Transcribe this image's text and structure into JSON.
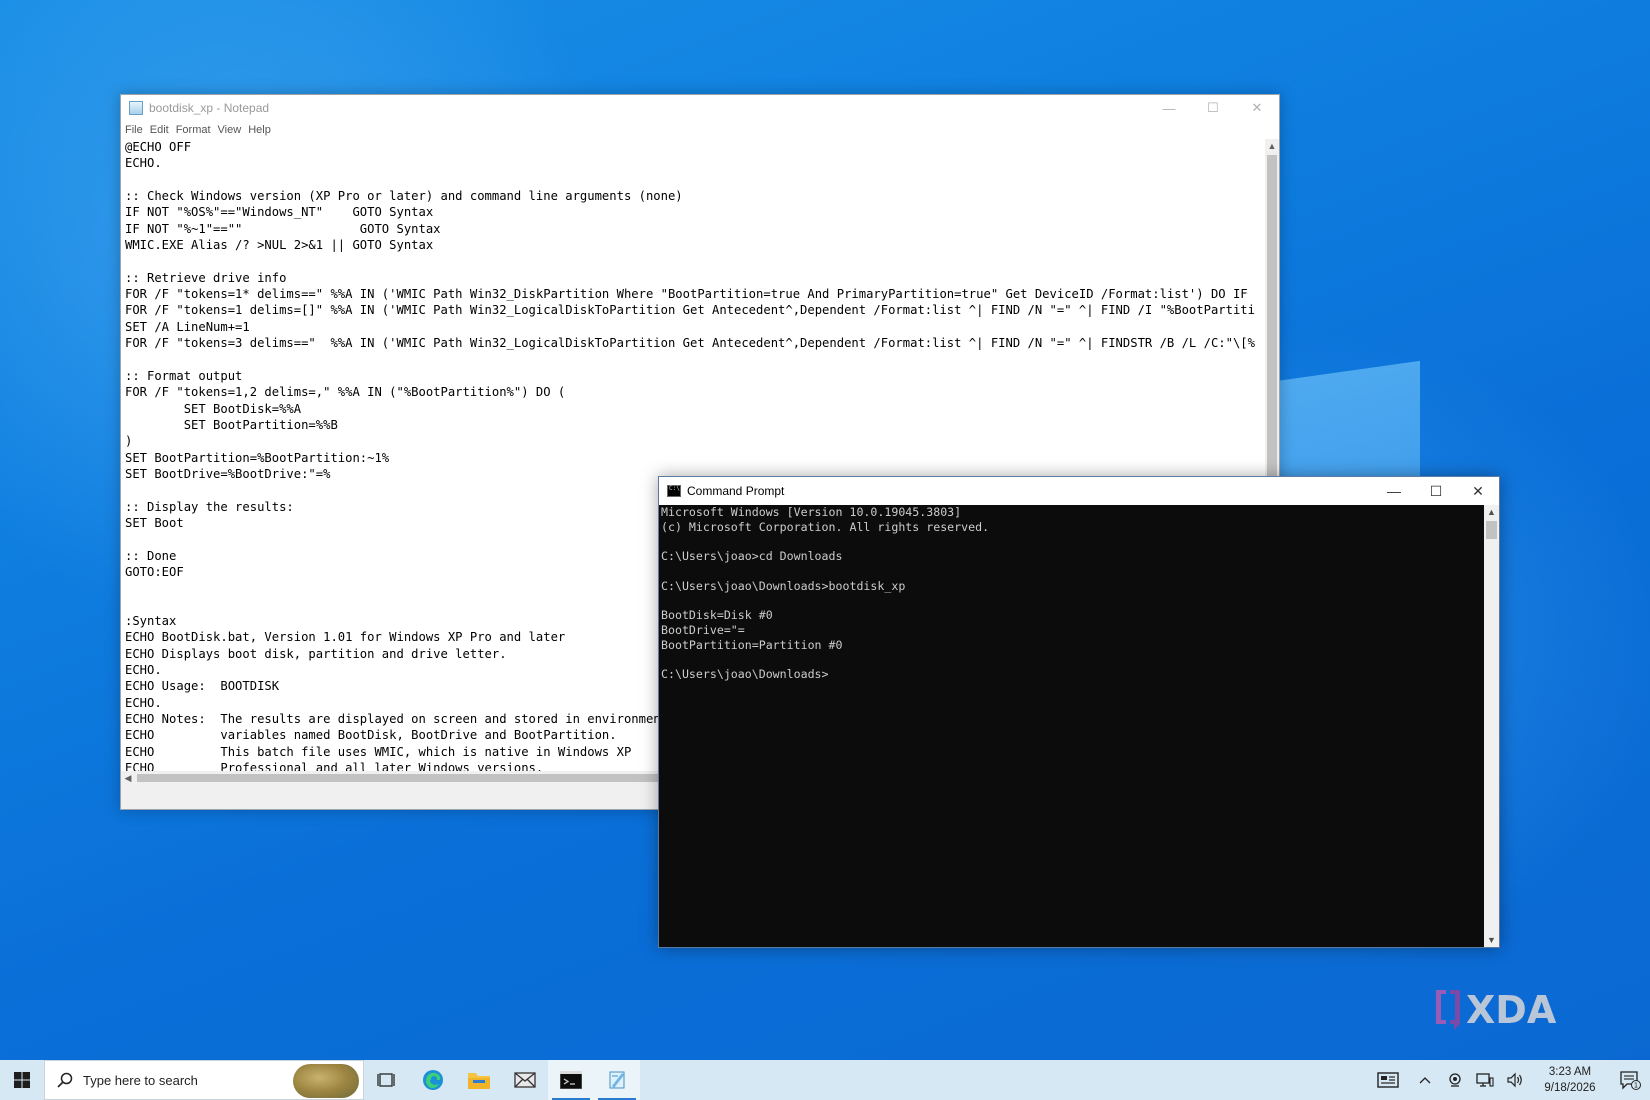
{
  "notepad": {
    "title": "bootdisk_xp - Notepad",
    "menu": [
      "File",
      "Edit",
      "Format",
      "View",
      "Help"
    ],
    "lines": [
      "@ECHO OFF",
      "ECHO.",
      "",
      ":: Check Windows version (XP Pro or later) and command line arguments (none)",
      "IF NOT \"%OS%\"==\"Windows_NT\"    GOTO Syntax",
      "IF NOT \"%~1\"==\"\"                GOTO Syntax",
      "WMIC.EXE Alias /? >NUL 2>&1 || GOTO Syntax",
      "",
      ":: Retrieve drive info",
      "FOR /F \"tokens=1* delims==\" %%A IN ('WMIC Path Win32_DiskPartition Where \"BootPartition=true And PrimaryPartition=true\" Get DeviceID /Format:list') DO IF",
      "FOR /F \"tokens=1 delims=[]\" %%A IN ('WMIC Path Win32_LogicalDiskToPartition Get Antecedent^,Dependent /Format:list ^| FIND /N \"=\" ^| FIND /I \"%BootPartiti",
      "SET /A LineNum+=1",
      "FOR /F \"tokens=3 delims==\"  %%A IN ('WMIC Path Win32_LogicalDiskToPartition Get Antecedent^,Dependent /Format:list ^| FIND /N \"=\" ^| FINDSTR /B /L /C:\"\\[%",
      "",
      ":: Format output",
      "FOR /F \"tokens=1,2 delims=,\" %%A IN (\"%BootPartition%\") DO (",
      "        SET BootDisk=%%A",
      "        SET BootPartition=%%B",
      ")",
      "SET BootPartition=%BootPartition:~1%",
      "SET BootDrive=%BootDrive:\"=%",
      "",
      ":: Display the results:",
      "SET Boot",
      "",
      ":: Done",
      "GOTO:EOF",
      "",
      "",
      ":Syntax",
      "ECHO BootDisk.bat, Version 1.01 for Windows XP Pro and later",
      "ECHO Displays boot disk, partition and drive letter.",
      "ECHO.",
      "ECHO Usage:  BOOTDISK",
      "ECHO.",
      "ECHO Notes:  The results are displayed on screen and stored in environment",
      "ECHO         variables named BootDisk, BootDrive and BootPartition.",
      "ECHO         This batch file uses WMIC, which is native in Windows XP",
      "ECHO         Professional and all later Windows versions."
    ]
  },
  "cmd": {
    "title": "Command Prompt",
    "lines": [
      "Microsoft Windows [Version 10.0.19045.3803]",
      "(c) Microsoft Corporation. All rights reserved.",
      "",
      "C:\\Users\\joao>cd Downloads",
      "",
      "C:\\Users\\joao\\Downloads>bootdisk_xp",
      "",
      "BootDisk=Disk #0",
      "BootDrive=\"=",
      "BootPartition=Partition #0",
      "",
      "C:\\Users\\joao\\Downloads>"
    ]
  },
  "watermark": {
    "text": "XDA"
  },
  "taskbar": {
    "search_placeholder": "Type here to search",
    "apps": [
      {
        "icon": "task-view-icon",
        "active": false
      },
      {
        "icon": "edge-icon",
        "active": false
      },
      {
        "icon": "file-explorer-icon",
        "active": false
      },
      {
        "icon": "mail-icon",
        "active": false
      },
      {
        "icon": "command-prompt-icon",
        "active": true
      },
      {
        "icon": "notepad-icon",
        "active": true
      }
    ],
    "time": "3:23 AM",
    "date": "9/18/2026",
    "notification_count": "1"
  },
  "colors": {
    "accent": "#0a6fd8",
    "cmd_background": "#0c0c0c",
    "cmd_text": "#cccccc"
  }
}
